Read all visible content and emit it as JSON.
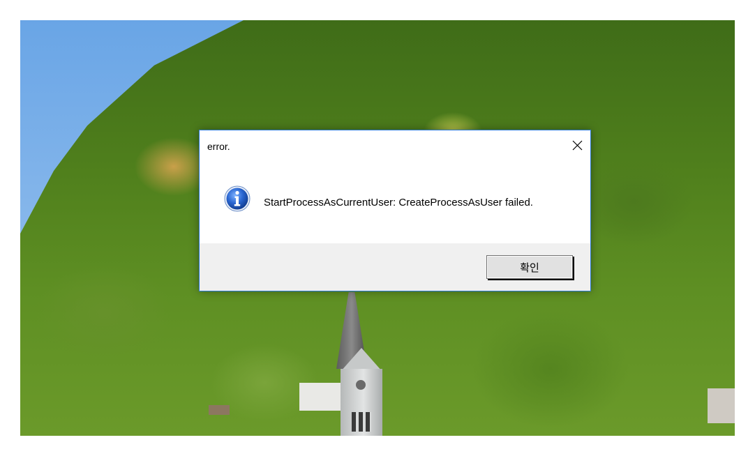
{
  "dialog": {
    "title": "error.",
    "message": "StartProcessAsCurrentUser: CreateProcessAsUser failed.",
    "icon": "information-icon",
    "ok_label": "확인",
    "close_icon": "close-icon",
    "accent_color": "#2b79d6"
  },
  "desktop": {
    "wallpaper": "mountain-forest-church"
  }
}
